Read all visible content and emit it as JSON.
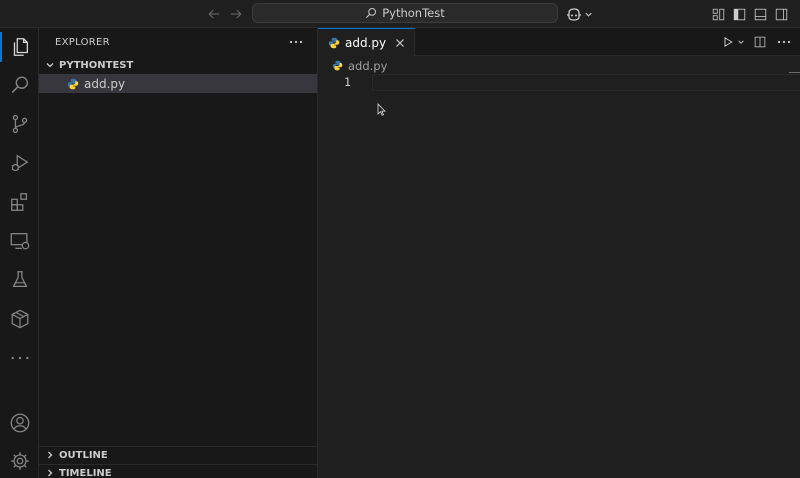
{
  "title_bar": {
    "search_text": "PythonTest",
    "icons": [
      "arrow-left-icon",
      "arrow-right-icon",
      "search-icon",
      "copilot-icon",
      "chevron-down-icon",
      "customize-layout-icon",
      "toggle-primary-sidebar-icon",
      "toggle-panel-icon",
      "toggle-secondary-sidebar-icon"
    ]
  },
  "activity_bar": {
    "items": [
      {
        "name": "explorer",
        "icon": "files-icon",
        "active": true
      },
      {
        "name": "search",
        "icon": "search-icon",
        "active": false
      },
      {
        "name": "source-control",
        "icon": "source-control-icon",
        "active": false
      },
      {
        "name": "run-and-debug",
        "icon": "run-debug-icon",
        "active": false
      },
      {
        "name": "extensions",
        "icon": "extensions-icon",
        "active": false
      },
      {
        "name": "remote-explorer",
        "icon": "remote-explorer-icon",
        "active": false
      },
      {
        "name": "testing",
        "icon": "beaker-icon",
        "active": false
      },
      {
        "name": "packages",
        "icon": "package-icon",
        "active": false
      },
      {
        "name": "more",
        "icon": "ellipsis-icon",
        "active": false
      }
    ],
    "bottom_items": [
      {
        "name": "accounts",
        "icon": "account-icon"
      },
      {
        "name": "manage",
        "icon": "gear-icon"
      }
    ]
  },
  "sidebar": {
    "header": "EXPLORER",
    "folder": "PYTHONTEST",
    "files": [
      {
        "name": "add.py",
        "icon": "python-icon",
        "selected": true
      }
    ],
    "sections": [
      {
        "label": "OUTLINE",
        "expanded": false
      },
      {
        "label": "TIMELINE",
        "expanded": false
      }
    ]
  },
  "editor": {
    "tabs": [
      {
        "label": "add.py",
        "icon": "python-icon",
        "active": true
      }
    ],
    "breadcrumb": "add.py",
    "line_numbers": [
      "1"
    ],
    "colors": {
      "accent": "#0078d4",
      "python_blue": "#3776ab",
      "python_yellow": "#ffd43b"
    }
  }
}
